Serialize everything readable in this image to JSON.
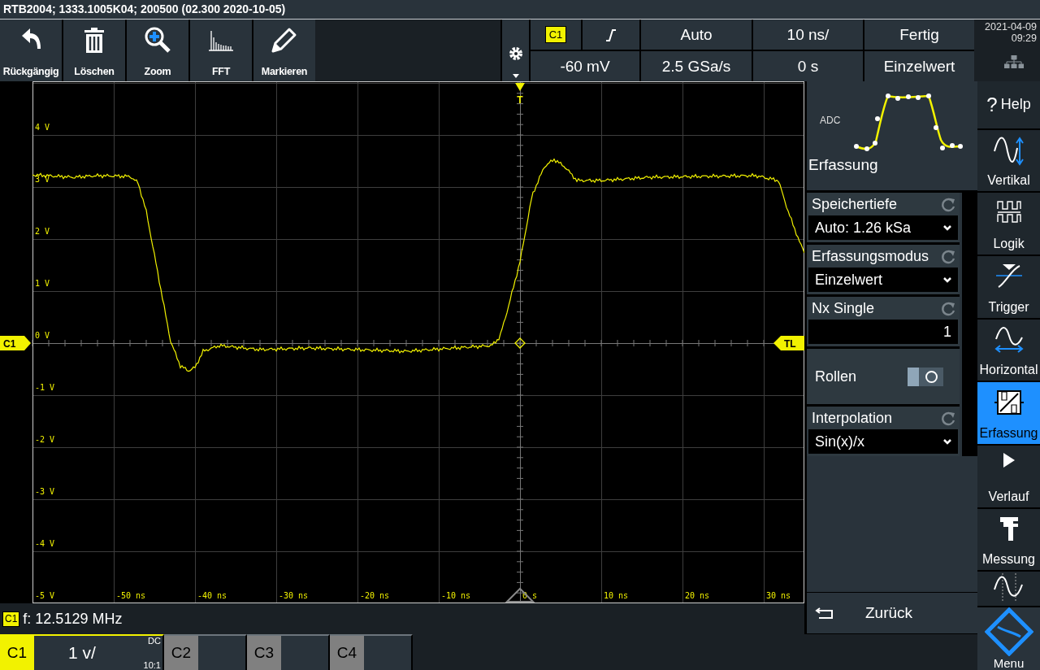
{
  "window": {
    "title": "RTB2004; 1333.1005K04; 200500 (02.300 2020-10-05)"
  },
  "toolbar": [
    {
      "label": "Rückgängig"
    },
    {
      "label": "Löschen"
    },
    {
      "label": "Zoom"
    },
    {
      "label": "FFT"
    },
    {
      "label": "Markieren"
    }
  ],
  "status": {
    "channel_badge": "C1",
    "trigger_mode": "Auto",
    "timebase": "10 ns/",
    "acquisition_state": "Fertig",
    "trigger_level": "-60 mV",
    "sample_rate": "2.5 GSa/s",
    "time_offset": "0 s",
    "run_mode": "Einzelwert",
    "date": "2021-04-09",
    "time": "09:29"
  },
  "plot": {
    "y_labels": [
      "4 V",
      "3 V",
      "2 V",
      "1 V",
      "0 V",
      "-1 V",
      "-2 V",
      "-3 V",
      "-4 V",
      "-5 V"
    ],
    "x_labels": [
      "-50 ns",
      "-40 ns",
      "-30 ns",
      "-20 ns",
      "-10 ns",
      "0 s",
      "10 ns",
      "20 ns",
      "30 ns"
    ],
    "channel_marker": "C1",
    "trigger_marker": "T",
    "trigger_level_marker": "TL"
  },
  "panel": {
    "adc_label": "ADC",
    "title": "Erfassung",
    "settings": [
      {
        "kind": "dropdown",
        "label": "Speichertiefe",
        "value": "Auto: 1.26 kSa"
      },
      {
        "kind": "dropdown",
        "label": "Erfassungsmodus",
        "value": "Einzelwert"
      },
      {
        "kind": "number",
        "label": "Nx Single",
        "value": "1"
      },
      {
        "kind": "toggle",
        "label": "Rollen",
        "on": false
      },
      {
        "kind": "dropdown",
        "label": "Interpolation",
        "value": "Sin(x)/x"
      }
    ],
    "back_button": "Zurück"
  },
  "side_menu": [
    {
      "label": "Help",
      "glyph": "?",
      "selected": false
    },
    {
      "label": "Vertikal",
      "selected": false
    },
    {
      "label": "Logik",
      "selected": false
    },
    {
      "label": "Trigger",
      "selected": false
    },
    {
      "label": "Horizontal",
      "selected": false
    },
    {
      "label": "Erfassung",
      "selected": true
    },
    {
      "label": "Verlauf",
      "selected": false
    },
    {
      "label": "Messung",
      "selected": false
    }
  ],
  "menu_button": "Menu",
  "measurement": {
    "channel": "C1",
    "text": "f: 12.5129 MHz"
  },
  "channels": [
    {
      "label": "C1",
      "active": true,
      "scale": "1 v/",
      "coupling": "DC",
      "probe": "10:1"
    },
    {
      "label": "C2",
      "active": false
    },
    {
      "label": "C3",
      "active": false
    },
    {
      "label": "C4",
      "active": false
    }
  ]
}
